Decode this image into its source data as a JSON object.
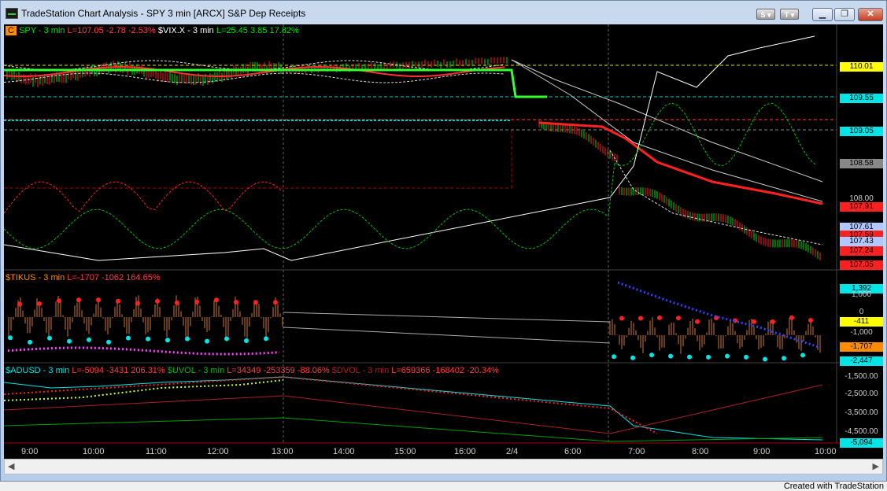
{
  "window": {
    "title": "TradeStation Chart Analysis - SPY 3 min [ARCX] S&P Dep Receipts",
    "toolbar_s": "S",
    "toolbar_t": "T"
  },
  "panel1": {
    "tag": "C",
    "spy_label": "SPY - 3 min",
    "spy_vals": "L=107.05  -2.78  -2.53%",
    "vix_label": "$VIX.X - 3 min",
    "vix_vals": "L=25.45  3.85  17.82%",
    "badges": [
      {
        "text": "110.01",
        "bg": "#ffff00",
        "fg": "#000000"
      },
      {
        "text": "109.55",
        "bg": "#00e5e5",
        "fg": "#000000"
      },
      {
        "text": "109.05",
        "bg": "#00e5e5",
        "fg": "#000000"
      },
      {
        "text": "108.58",
        "bg": "#888888",
        "fg": "#000000"
      },
      {
        "text": "108.00",
        "bg": "none",
        "fg": "#cccccc"
      },
      {
        "text": "107.91",
        "bg": "#ff2020",
        "fg": "#000000"
      },
      {
        "text": "107.61",
        "bg": "#b0c8ff",
        "fg": "#000000"
      },
      {
        "text": "107.59",
        "bg": "#ff2020",
        "fg": "#000000"
      },
      {
        "text": "107.43",
        "bg": "#b0c8ff",
        "fg": "#000000"
      },
      {
        "text": "107.24",
        "bg": "#ff2020",
        "fg": "#000000"
      },
      {
        "text": "107.05",
        "bg": "#ff2020",
        "fg": "#000000"
      }
    ]
  },
  "panel2": {
    "label": "$TIKUS - 3 min",
    "vals": "L=-1707  -1062  164.65%",
    "badges": [
      {
        "text": "1,392",
        "bg": "#00e5e5",
        "fg": "#000000"
      },
      {
        "text": "1,000",
        "bg": "none",
        "fg": "#cccccc"
      },
      {
        "text": "0",
        "bg": "none",
        "fg": "#cccccc"
      },
      {
        "text": "-411",
        "bg": "#ffff00",
        "fg": "#000000"
      },
      {
        "text": "-1,000",
        "bg": "none",
        "fg": "#cccccc"
      },
      {
        "text": "-1,707",
        "bg": "#ff8c00",
        "fg": "#000000"
      },
      {
        "text": "-2,447",
        "bg": "#00e5e5",
        "fg": "#000000"
      }
    ]
  },
  "panel3": {
    "adusd_label": "$ADUSD - 3 min",
    "adusd_vals": "L=-5094  -3431  206.31%",
    "uvol_label": "$UVOL - 3 min",
    "uvol_vals": "L=34349  -253359  -88.06%",
    "dvol_label": "$DVOL - 3 min",
    "dvol_vals": "L=659366  -168402  -20.34%",
    "badges": [
      {
        "text": "-1,500.00",
        "bg": "none",
        "fg": "#cccccc"
      },
      {
        "text": "-2,500.00",
        "bg": "none",
        "fg": "#cccccc"
      },
      {
        "text": "-3,500.00",
        "bg": "none",
        "fg": "#cccccc"
      },
      {
        "text": "-4,500.00",
        "bg": "none",
        "fg": "#cccccc"
      },
      {
        "text": "-5,094",
        "bg": "#00e5e5",
        "fg": "#000000"
      }
    ]
  },
  "time_axis": [
    "9:00",
    "10:00",
    "11:00",
    "12:00",
    "13:00",
    "14:00",
    "15:00",
    "16:00",
    "2/4",
    "6:00",
    "7:00",
    "8:00",
    "9:00",
    "10:00"
  ],
  "footer": {
    "credit": "Created with TradeStation"
  },
  "colors": {
    "up": "#00e000",
    "down": "#ff2020",
    "vix": "#00c000",
    "cyan": "#00e5e5"
  }
}
